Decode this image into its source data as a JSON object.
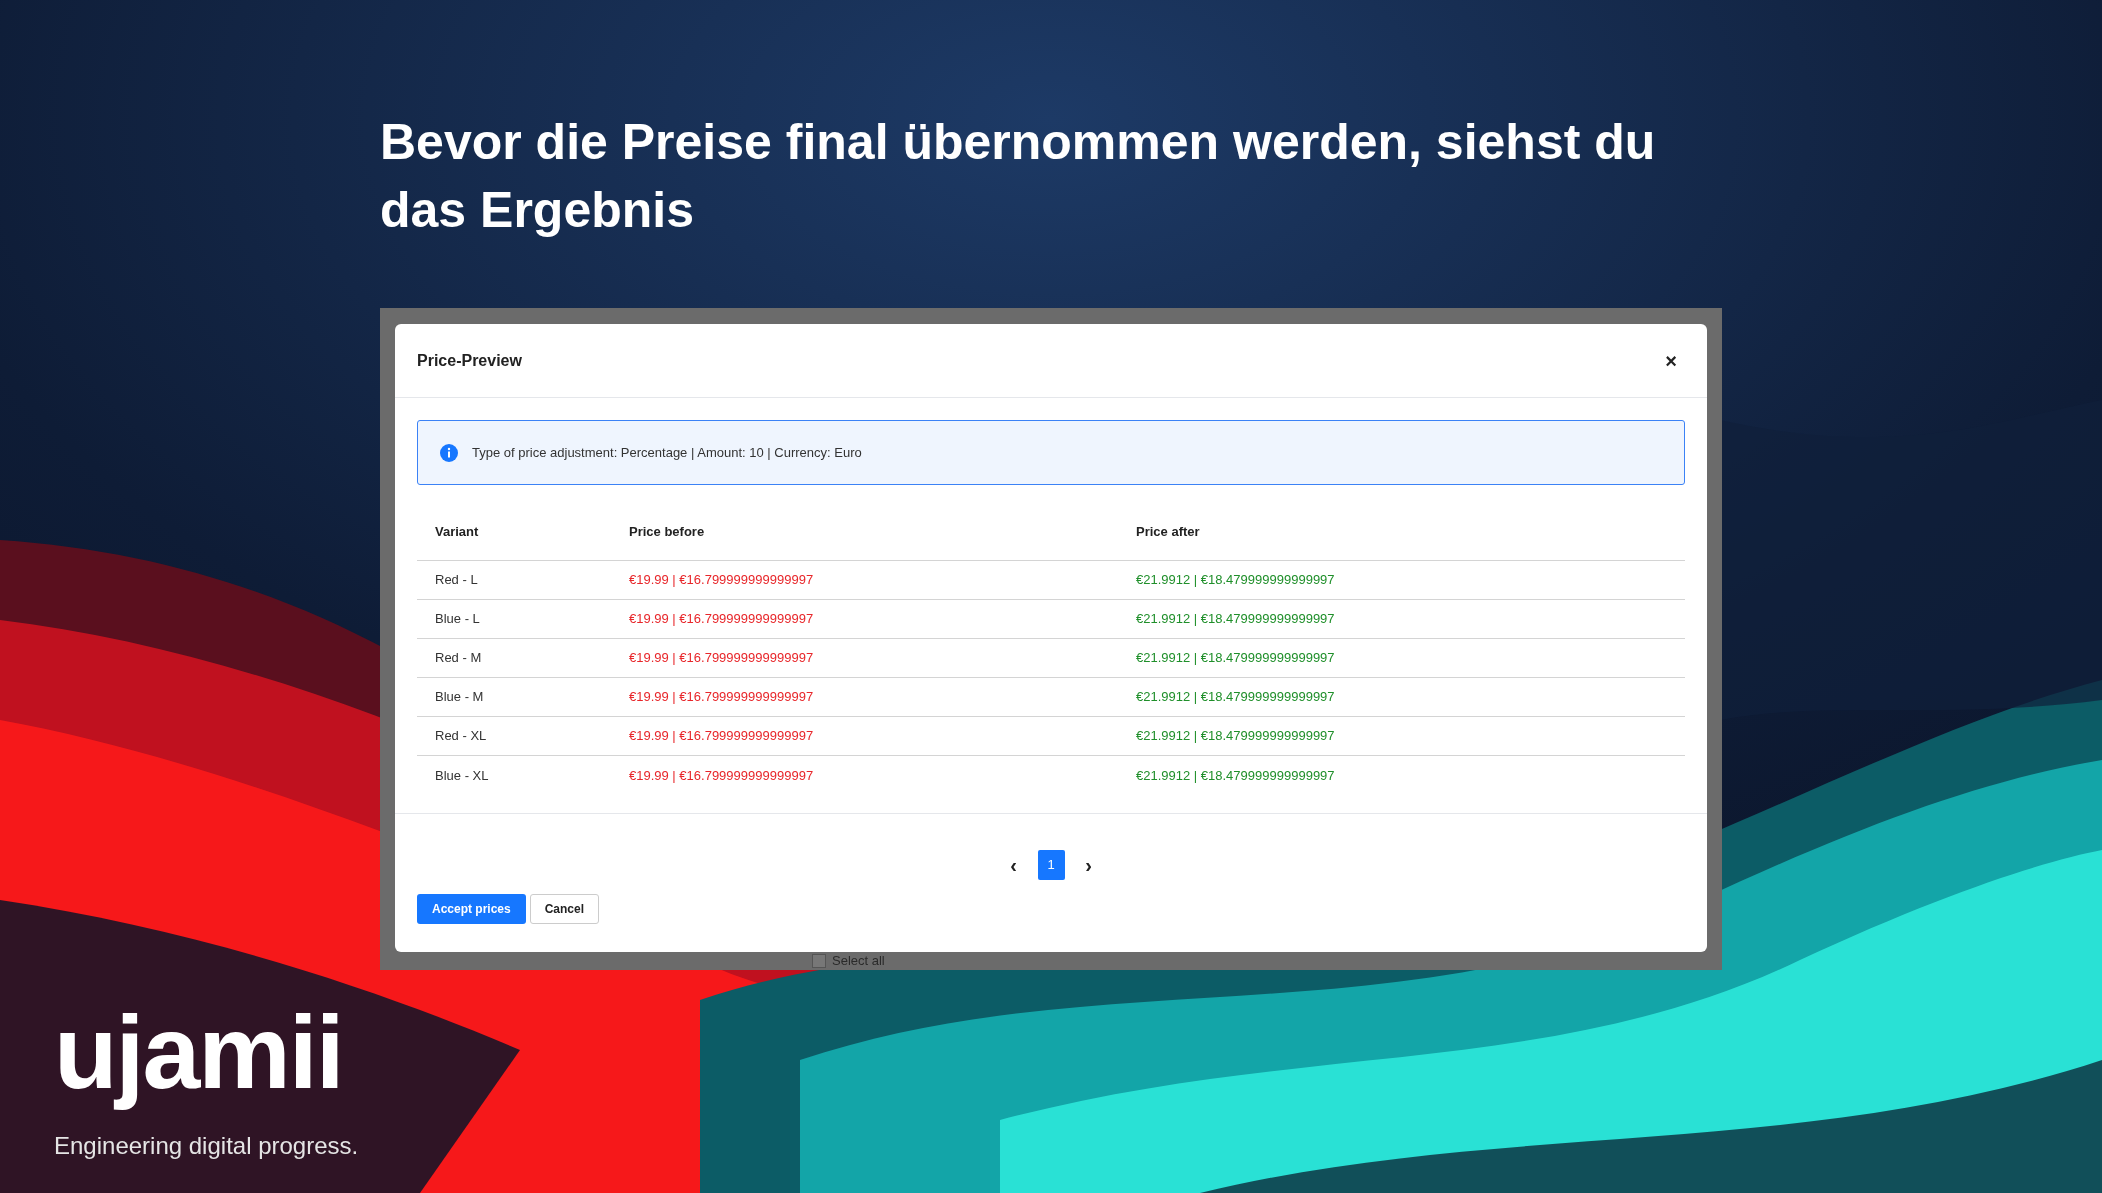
{
  "headline": "Bevor die Preise final übernommen werden, siehst du das Ergebnis",
  "dialog": {
    "title": "Price-Preview",
    "close": "×",
    "info": "Type of price adjustment: Percentage | Amount: 10 | Currency: Euro",
    "table": {
      "columns": [
        "Variant",
        "Price before",
        "Price after"
      ],
      "rows": [
        {
          "variant": "Red - L",
          "before": "€19.99 | €16.799999999999997",
          "after": "€21.9912 | €18.479999999999997"
        },
        {
          "variant": "Blue - L",
          "before": "€19.99 | €16.799999999999997",
          "after": "€21.9912 | €18.479999999999997"
        },
        {
          "variant": "Red - M",
          "before": "€19.99 | €16.799999999999997",
          "after": "€21.9912 | €18.479999999999997"
        },
        {
          "variant": "Blue - M",
          "before": "€19.99 | €16.799999999999997",
          "after": "€21.9912 | €18.479999999999997"
        },
        {
          "variant": "Red - XL",
          "before": "€19.99 | €16.799999999999997",
          "after": "€21.9912 | €18.479999999999997"
        },
        {
          "variant": "Blue - XL",
          "before": "€19.99 | €16.799999999999997",
          "after": "€21.9912 | €18.479999999999997"
        }
      ]
    },
    "pagination": {
      "prev": "‹",
      "pages": [
        {
          "label": "1",
          "selected": true
        }
      ],
      "next": "›"
    },
    "buttons": [
      {
        "label": "Accept prices",
        "kind": "primary"
      },
      {
        "label": "Cancel",
        "kind": "secondary"
      }
    ]
  },
  "behind": {
    "select_all": {
      "label": "Select all",
      "checked": false
    }
  },
  "logo": {
    "wordmark": "ujamii",
    "tagline": "Engineering digital progress."
  }
}
